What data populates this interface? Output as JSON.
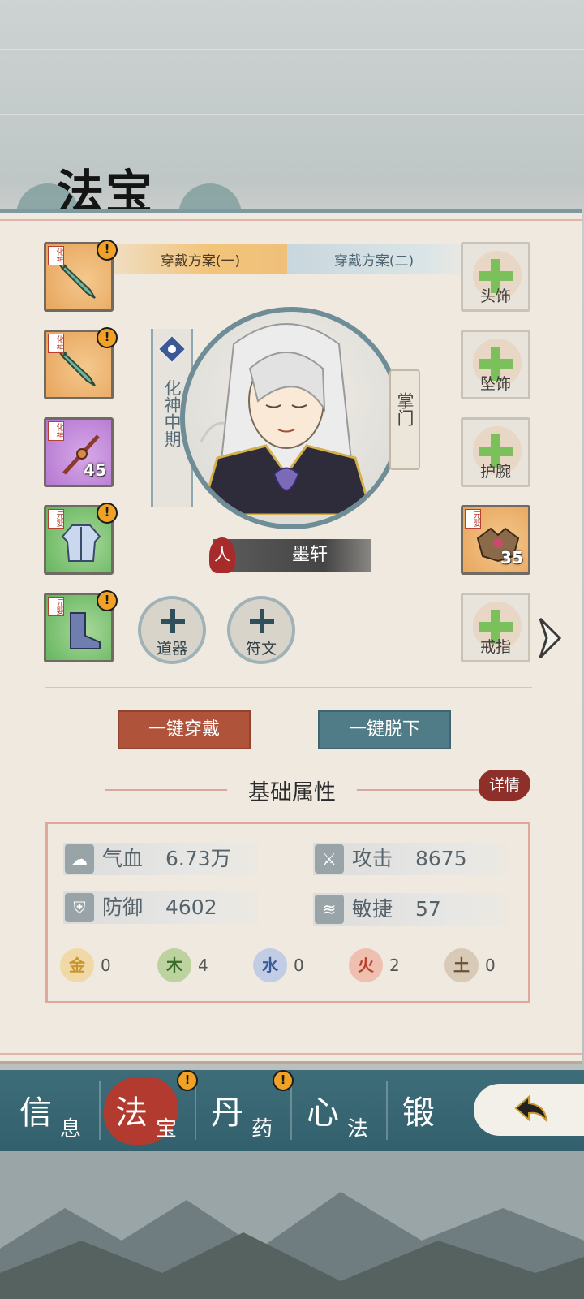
{
  "title": "法宝",
  "tabs": [
    {
      "label": "穿戴方案(一)",
      "active": true
    },
    {
      "label": "穿戴方案(二)",
      "active": false
    }
  ],
  "left_slots": [
    {
      "item": "dagger",
      "realm": "化神",
      "rarity": "orange",
      "alert": "!"
    },
    {
      "item": "dagger",
      "realm": "化神",
      "rarity": "orange",
      "alert": "!"
    },
    {
      "item": "spear",
      "realm": "化神",
      "rarity": "purple",
      "level": "45"
    },
    {
      "item": "robe",
      "realm": "元婴",
      "rarity": "green",
      "alert": "!"
    },
    {
      "item": "boots",
      "realm": "元婴",
      "rarity": "green",
      "alert": "!"
    }
  ],
  "right_slots": [
    {
      "label": "头饰"
    },
    {
      "label": "坠饰"
    },
    {
      "label": "护腕"
    },
    {
      "item": "shoulder-armor",
      "realm": "元婴",
      "rarity": "orange",
      "level": "35"
    },
    {
      "label": "戒指"
    }
  ],
  "character": {
    "realm": "化神中期",
    "sect_role": "掌门",
    "race_badge": "人",
    "name": "墨轩"
  },
  "extra_slots": [
    {
      "label": "道器"
    },
    {
      "label": "符文"
    }
  ],
  "actions": {
    "equip_all": "一键穿戴",
    "unequip_all": "一键脱下"
  },
  "attributes": {
    "title": "基础属性",
    "detail_label": "详情",
    "stats": [
      {
        "name": "气血",
        "value": "6.73万",
        "icon": "blood-icon"
      },
      {
        "name": "攻击",
        "value": "8675",
        "icon": "attack-icon"
      },
      {
        "name": "防御",
        "value": "4602",
        "icon": "shield-icon"
      },
      {
        "name": "敏捷",
        "value": "57",
        "icon": "wind-icon"
      }
    ],
    "elements": [
      {
        "glyph": "金",
        "value": "0",
        "color": "#e0b25a"
      },
      {
        "glyph": "木",
        "value": "4",
        "color": "#7aa95a"
      },
      {
        "glyph": "水",
        "value": "0",
        "color": "#6f8ec4"
      },
      {
        "glyph": "火",
        "value": "2",
        "color": "#d9715c"
      },
      {
        "glyph": "土",
        "value": "0",
        "color": "#a08a72"
      }
    ]
  },
  "nav": [
    {
      "big": "信",
      "small": "息",
      "active": false
    },
    {
      "big": "法",
      "small": "宝",
      "active": true,
      "alert": "!"
    },
    {
      "big": "丹",
      "small": "药",
      "active": false,
      "alert": "!"
    },
    {
      "big": "心",
      "small": "法",
      "active": false
    },
    {
      "big": "锻",
      "small": "",
      "active": false
    }
  ],
  "colors": {
    "accent_red": "#b0533b",
    "accent_teal": "#4f7c86",
    "nav_bg": "#3e6d7a",
    "alert": "#f0a126"
  }
}
